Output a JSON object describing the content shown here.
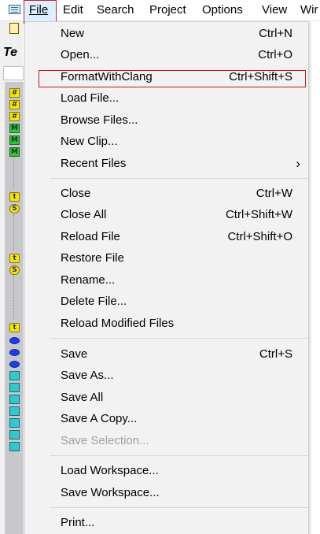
{
  "menubar": {
    "items": [
      {
        "label": "File"
      },
      {
        "label": "Edit"
      },
      {
        "label": "Search"
      },
      {
        "label": "Project"
      },
      {
        "label": "Options"
      },
      {
        "label": "View"
      },
      {
        "label": "Wir"
      }
    ]
  },
  "background": {
    "title_fragment": "Te",
    "tree_icon_letters": {
      "hash": "#",
      "m": "M",
      "t": "t",
      "s": "S"
    }
  },
  "file_menu": {
    "items": [
      {
        "label": "New",
        "shortcut": "Ctrl+N"
      },
      {
        "label": "Open...",
        "shortcut": "Ctrl+O"
      },
      {
        "label": "FormatWithClang",
        "shortcut": "Ctrl+Shift+S"
      },
      {
        "label": "Load File...",
        "shortcut": ""
      },
      {
        "label": "Browse Files...",
        "shortcut": ""
      },
      {
        "label": "New Clip...",
        "shortcut": ""
      },
      {
        "label": "Recent Files",
        "shortcut": ""
      },
      {
        "label": "Close",
        "shortcut": "Ctrl+W"
      },
      {
        "label": "Close All",
        "shortcut": "Ctrl+Shift+W"
      },
      {
        "label": "Reload File",
        "shortcut": "Ctrl+Shift+O"
      },
      {
        "label": "Restore File",
        "shortcut": ""
      },
      {
        "label": "Rename...",
        "shortcut": ""
      },
      {
        "label": "Delete File...",
        "shortcut": ""
      },
      {
        "label": "Reload Modified Files",
        "shortcut": ""
      },
      {
        "label": "Save",
        "shortcut": "Ctrl+S"
      },
      {
        "label": "Save As...",
        "shortcut": ""
      },
      {
        "label": "Save All",
        "shortcut": ""
      },
      {
        "label": "Save A Copy...",
        "shortcut": ""
      },
      {
        "label": "Save Selection...",
        "shortcut": "",
        "disabled": true
      },
      {
        "label": "Load Workspace...",
        "shortcut": ""
      },
      {
        "label": "Save Workspace...",
        "shortcut": ""
      },
      {
        "label": "Print...",
        "shortcut": ""
      }
    ],
    "submenu_arrow": "›"
  },
  "colors": {
    "highlight_border": "#c0272d",
    "menu_background": "#f2f2f2",
    "disabled_text": "#a0a0a0"
  }
}
